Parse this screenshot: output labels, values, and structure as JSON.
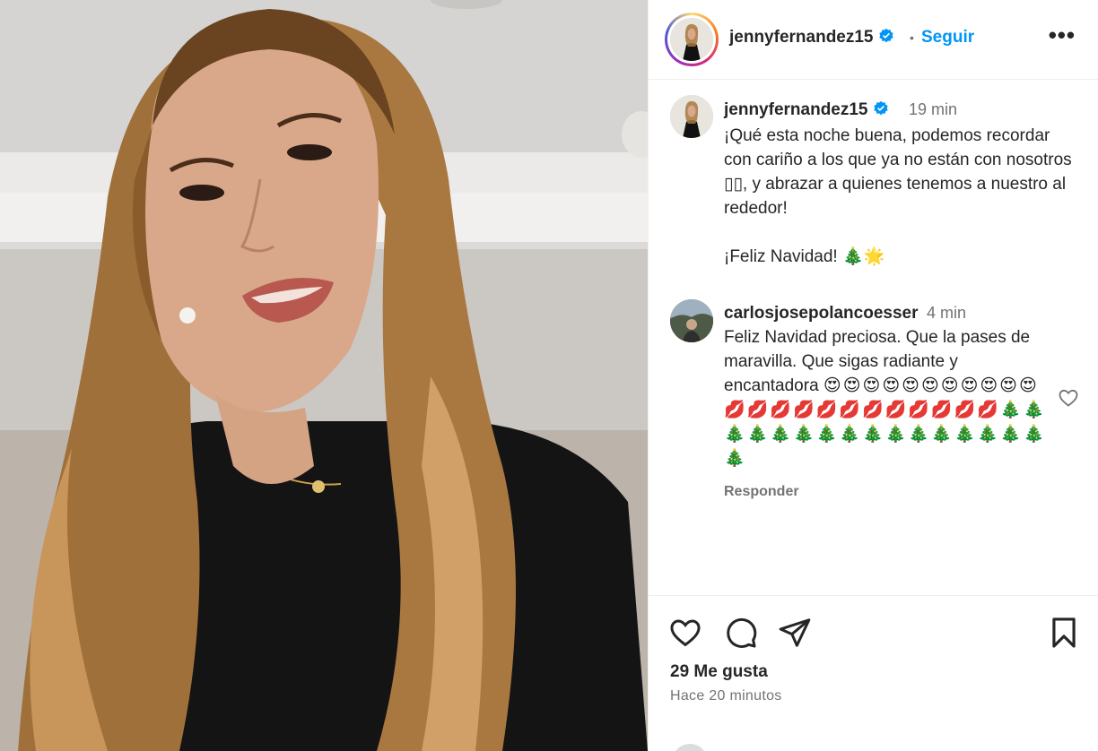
{
  "post": {
    "username": "jennyfernandez15",
    "follow_label": "Seguir",
    "more_label": "•••",
    "dot": "•",
    "caption": {
      "username": "jennyfernandez15",
      "time": "19 min",
      "text": "¡Qué esta noche buena, podemos recordar con cariño a los que ya no están con nosotros ▯▯, y abrazar a quienes tenemos a nuestro al rededor!\n\n¡Feliz Navidad! 🎄🌟"
    },
    "comment": {
      "username": "carlosjosepolancoesser",
      "time": "4 min",
      "text": "Feliz Navidad preciosa. Que la pases de maravilla. Que sigas radiante y encantadora ",
      "emojis": "😍😍😍😍😍😍😍😍😍😍😍💋💋💋💋💋💋💋💋💋💋💋💋🎄🎄🎄🎄🎄🎄🎄🎄🎄🎄🎄🎄🎄🎄🎄🎄🎄",
      "reply_label": "Responder"
    },
    "likes": "29 Me gusta",
    "time_ago": "Hace 20 minutos",
    "colors": {
      "accent": "#0095f6",
      "verified": "#0095f6",
      "text": "#262626",
      "muted": "#737373"
    },
    "icons": [
      "heart-icon",
      "comment-icon",
      "share-icon",
      "bookmark-icon",
      "verified-icon",
      "more-icon"
    ]
  }
}
